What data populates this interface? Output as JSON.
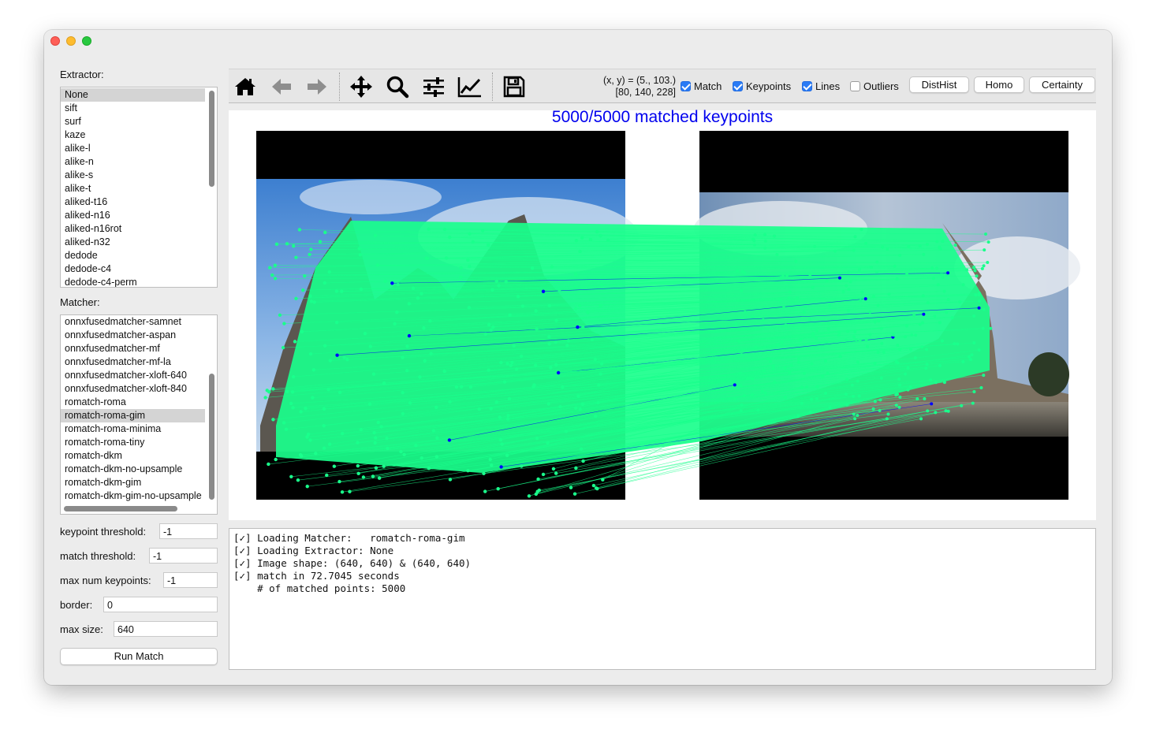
{
  "window": {
    "traffic_lights": [
      "close",
      "minimize",
      "zoom"
    ]
  },
  "extractor": {
    "label": "Extractor:",
    "items": [
      "None",
      "sift",
      "surf",
      "kaze",
      "alike-l",
      "alike-n",
      "alike-s",
      "alike-t",
      "aliked-t16",
      "aliked-n16",
      "aliked-n16rot",
      "aliked-n32",
      "dedode",
      "dedode-c4",
      "dedode-c4-perm"
    ],
    "selected": "None"
  },
  "matcher": {
    "label": "Matcher:",
    "items": [
      "onnxfusedmatcher-samnet",
      "onnxfusedmatcher-aspan",
      "onnxfusedmatcher-mf",
      "onnxfusedmatcher-mf-la",
      "onnxfusedmatcher-xloft-640",
      "onnxfusedmatcher-xloft-840",
      "romatch-roma",
      "romatch-roma-gim",
      "romatch-roma-minima",
      "romatch-roma-tiny",
      "romatch-dkm",
      "romatch-dkm-no-upsample",
      "romatch-dkm-gim",
      "romatch-dkm-gim-no-upsample"
    ],
    "selected": "romatch-roma-gim"
  },
  "params": {
    "keypoint_threshold": {
      "label": "keypoint threshold:",
      "value": "-1"
    },
    "match_threshold": {
      "label": "match threshold:",
      "value": "-1"
    },
    "max_num_keypoints": {
      "label": "max num keypoints:",
      "value": "-1"
    },
    "border": {
      "label": "border:",
      "value": "0"
    },
    "max_size": {
      "label": "max size:",
      "value": "640"
    }
  },
  "run_button": "Run Match",
  "toolbar": {
    "icons": [
      "home-icon",
      "back-arrow-icon",
      "forward-arrow-icon",
      "pan-icon",
      "zoom-icon",
      "configure-subplots-icon",
      "edit-axis-icon",
      "save-icon"
    ],
    "coord_line1": "(x, y) = (5., 103.)",
    "coord_line2": "[80, 140, 228]",
    "checkboxes": [
      {
        "label": "Match",
        "checked": true
      },
      {
        "label": "Keypoints",
        "checked": true
      },
      {
        "label": "Lines",
        "checked": true
      },
      {
        "label": "Outliers",
        "checked": false
      }
    ],
    "buttons": [
      "DistHist",
      "Homo",
      "Certainty"
    ]
  },
  "plot": {
    "title": "5000/5000 matched keypoints",
    "colors": {
      "inlier": "#1aff8c",
      "outlier": "#0000ff",
      "title": "#0000ee"
    }
  },
  "log": {
    "lines": [
      "[✓] Loading Matcher:   romatch-roma-gim",
      "[✓] Loading Extractor: None",
      "[✓] Image shape: (640, 640) & (640, 640)",
      "[✓] match in 72.7045 seconds",
      "    # of matched points: 5000"
    ]
  }
}
